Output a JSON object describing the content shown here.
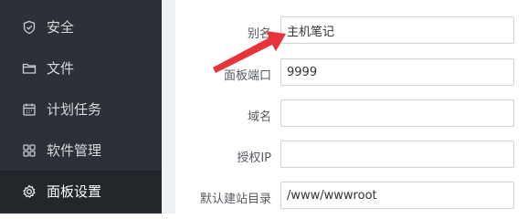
{
  "sidebar": {
    "items": [
      {
        "label": "安全",
        "icon": "shield-check-icon",
        "active": false
      },
      {
        "label": "文件",
        "icon": "folder-icon",
        "active": false
      },
      {
        "label": "计划任务",
        "icon": "calendar-icon",
        "active": false
      },
      {
        "label": "软件管理",
        "icon": "grid-apps-icon",
        "active": false
      },
      {
        "label": "面板设置",
        "icon": "gear-icon",
        "active": true
      }
    ]
  },
  "form": {
    "alias": {
      "label": "别名",
      "value": "主机笔记"
    },
    "port": {
      "label": "面板端口",
      "value": "9999"
    },
    "domain": {
      "label": "域名",
      "value": ""
    },
    "auth_ip": {
      "label": "授权IP",
      "value": ""
    },
    "site_dir": {
      "label": "默认建站目录",
      "value": "/www/wwwroot"
    }
  },
  "annotation": {
    "arrow_color": "#e8333a"
  },
  "colors": {
    "sidebar_bg": "#2c3138",
    "sidebar_active": "#23272c",
    "divider": "#eef0f2"
  }
}
